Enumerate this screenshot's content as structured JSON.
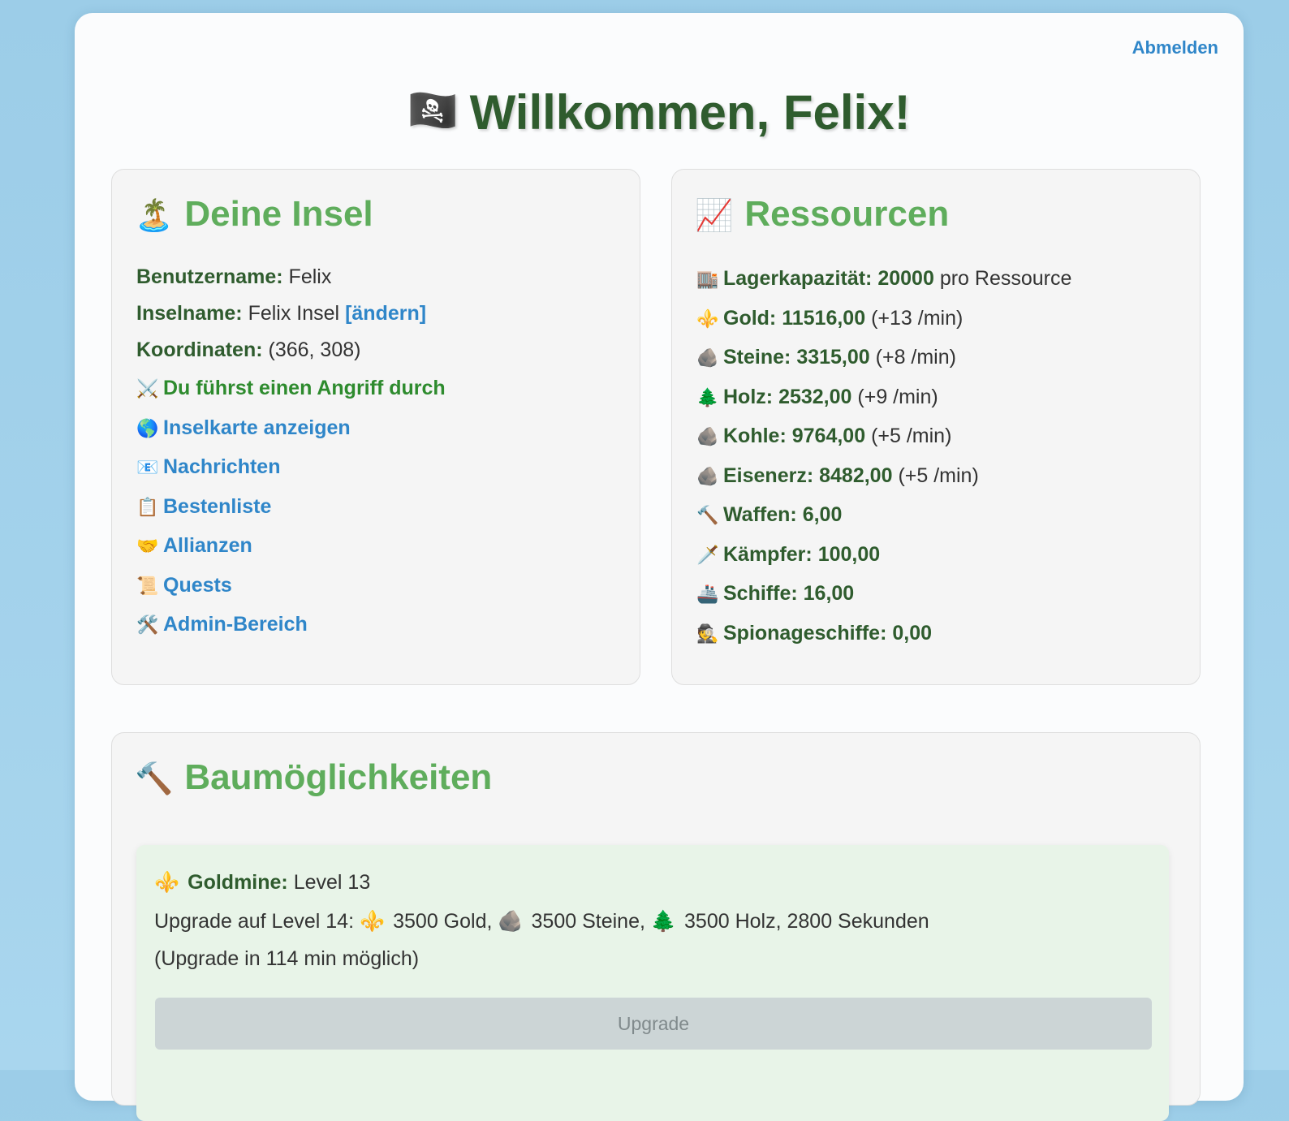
{
  "header": {
    "logout": "Abmelden",
    "title_icon": "🏴‍☠️",
    "title": "Willkommen, Felix!"
  },
  "island": {
    "icon": "🏝️",
    "title": "Deine Insel",
    "username_label": "Benutzername:",
    "username": "Felix",
    "islandname_label": "Inselname:",
    "islandname": "Felix Insel",
    "change_link": "[ändern]",
    "coords_label": "Koordinaten:",
    "coords": "(366, 308)",
    "attack_icon": "⚔️",
    "attack_text": "Du führst einen Angriff durch",
    "links": [
      {
        "icon": "🌎",
        "label": "Inselkarte anzeigen"
      },
      {
        "icon": "📧",
        "label": "Nachrichten"
      },
      {
        "icon": "📋",
        "label": "Bestenliste"
      },
      {
        "icon": "🤝",
        "label": "Allianzen"
      },
      {
        "icon": "📜",
        "label": "Quests"
      },
      {
        "icon": "🛠️",
        "label": "Admin-Bereich"
      }
    ]
  },
  "resources": {
    "icon": "📈",
    "title": "Ressourcen",
    "capacity": {
      "icon": "🏬",
      "label": "Lagerkapazität:",
      "value": "20000",
      "suffix": "pro Ressource"
    },
    "items": [
      {
        "icon": "⚜️",
        "label": "Gold:",
        "value": "11516,00",
        "rate": "(+13 /min)"
      },
      {
        "icon": "🪨",
        "label": "Steine:",
        "value": "3315,00",
        "rate": "(+8 /min)"
      },
      {
        "icon": "🌲",
        "label": "Holz:",
        "value": "2532,00",
        "rate": "(+9 /min)"
      },
      {
        "icon": "🪨",
        "label": "Kohle:",
        "value": "9764,00",
        "rate": "(+5 /min)"
      },
      {
        "icon": "🪨",
        "label": "Eisenerz:",
        "value": "8482,00",
        "rate": "(+5 /min)"
      },
      {
        "icon": "🔨",
        "label": "Waffen:",
        "value": "6,00",
        "rate": ""
      },
      {
        "icon": "🗡️",
        "label": "Kämpfer:",
        "value": "100,00",
        "rate": ""
      },
      {
        "icon": "🚢",
        "label": "Schiffe:",
        "value": "16,00",
        "rate": ""
      },
      {
        "icon": "🕵️",
        "label": "Spionageschiffe:",
        "value": "0,00",
        "rate": ""
      }
    ]
  },
  "build": {
    "icon": "🔨",
    "title": "Baumöglichkeiten",
    "item": {
      "icon": "⚜️",
      "name": "Goldmine:",
      "level": "Level 13",
      "upgrade_prefix": "Upgrade auf Level 14:",
      "cost_gold_icon": "⚜️",
      "cost_gold": "3500 Gold,",
      "cost_stone_icon": "🪨",
      "cost_stone": "3500 Steine,",
      "cost_wood_icon": "🌲",
      "cost_wood": "3500 Holz, 2800 Sekunden",
      "possible_text": "(Upgrade in 114 min möglich)",
      "button": "Upgrade"
    }
  }
}
